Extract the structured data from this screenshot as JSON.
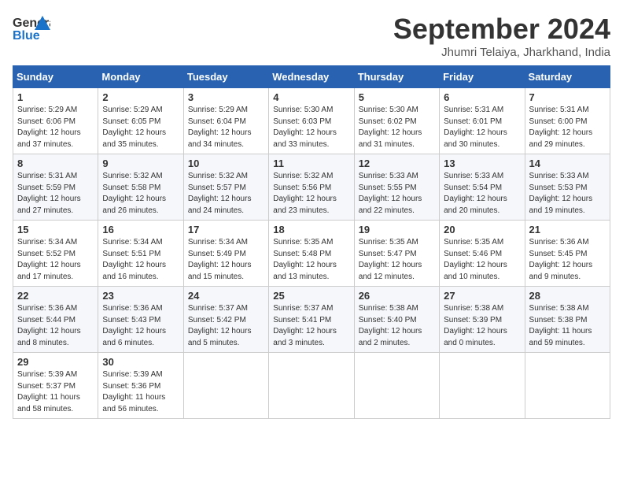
{
  "header": {
    "logo_line1": "General",
    "logo_line2": "Blue",
    "month_title": "September 2024",
    "location": "Jhumri Telaiya, Jharkhand, India"
  },
  "days_of_week": [
    "Sunday",
    "Monday",
    "Tuesday",
    "Wednesday",
    "Thursday",
    "Friday",
    "Saturday"
  ],
  "weeks": [
    [
      {
        "day": "1",
        "lines": [
          "Sunrise: 5:29 AM",
          "Sunset: 6:06 PM",
          "Daylight: 12 hours",
          "and 37 minutes."
        ]
      },
      {
        "day": "2",
        "lines": [
          "Sunrise: 5:29 AM",
          "Sunset: 6:05 PM",
          "Daylight: 12 hours",
          "and 35 minutes."
        ]
      },
      {
        "day": "3",
        "lines": [
          "Sunrise: 5:29 AM",
          "Sunset: 6:04 PM",
          "Daylight: 12 hours",
          "and 34 minutes."
        ]
      },
      {
        "day": "4",
        "lines": [
          "Sunrise: 5:30 AM",
          "Sunset: 6:03 PM",
          "Daylight: 12 hours",
          "and 33 minutes."
        ]
      },
      {
        "day": "5",
        "lines": [
          "Sunrise: 5:30 AM",
          "Sunset: 6:02 PM",
          "Daylight: 12 hours",
          "and 31 minutes."
        ]
      },
      {
        "day": "6",
        "lines": [
          "Sunrise: 5:31 AM",
          "Sunset: 6:01 PM",
          "Daylight: 12 hours",
          "and 30 minutes."
        ]
      },
      {
        "day": "7",
        "lines": [
          "Sunrise: 5:31 AM",
          "Sunset: 6:00 PM",
          "Daylight: 12 hours",
          "and 29 minutes."
        ]
      }
    ],
    [
      {
        "day": "8",
        "lines": [
          "Sunrise: 5:31 AM",
          "Sunset: 5:59 PM",
          "Daylight: 12 hours",
          "and 27 minutes."
        ]
      },
      {
        "day": "9",
        "lines": [
          "Sunrise: 5:32 AM",
          "Sunset: 5:58 PM",
          "Daylight: 12 hours",
          "and 26 minutes."
        ]
      },
      {
        "day": "10",
        "lines": [
          "Sunrise: 5:32 AM",
          "Sunset: 5:57 PM",
          "Daylight: 12 hours",
          "and 24 minutes."
        ]
      },
      {
        "day": "11",
        "lines": [
          "Sunrise: 5:32 AM",
          "Sunset: 5:56 PM",
          "Daylight: 12 hours",
          "and 23 minutes."
        ]
      },
      {
        "day": "12",
        "lines": [
          "Sunrise: 5:33 AM",
          "Sunset: 5:55 PM",
          "Daylight: 12 hours",
          "and 22 minutes."
        ]
      },
      {
        "day": "13",
        "lines": [
          "Sunrise: 5:33 AM",
          "Sunset: 5:54 PM",
          "Daylight: 12 hours",
          "and 20 minutes."
        ]
      },
      {
        "day": "14",
        "lines": [
          "Sunrise: 5:33 AM",
          "Sunset: 5:53 PM",
          "Daylight: 12 hours",
          "and 19 minutes."
        ]
      }
    ],
    [
      {
        "day": "15",
        "lines": [
          "Sunrise: 5:34 AM",
          "Sunset: 5:52 PM",
          "Daylight: 12 hours",
          "and 17 minutes."
        ]
      },
      {
        "day": "16",
        "lines": [
          "Sunrise: 5:34 AM",
          "Sunset: 5:51 PM",
          "Daylight: 12 hours",
          "and 16 minutes."
        ]
      },
      {
        "day": "17",
        "lines": [
          "Sunrise: 5:34 AM",
          "Sunset: 5:49 PM",
          "Daylight: 12 hours",
          "and 15 minutes."
        ]
      },
      {
        "day": "18",
        "lines": [
          "Sunrise: 5:35 AM",
          "Sunset: 5:48 PM",
          "Daylight: 12 hours",
          "and 13 minutes."
        ]
      },
      {
        "day": "19",
        "lines": [
          "Sunrise: 5:35 AM",
          "Sunset: 5:47 PM",
          "Daylight: 12 hours",
          "and 12 minutes."
        ]
      },
      {
        "day": "20",
        "lines": [
          "Sunrise: 5:35 AM",
          "Sunset: 5:46 PM",
          "Daylight: 12 hours",
          "and 10 minutes."
        ]
      },
      {
        "day": "21",
        "lines": [
          "Sunrise: 5:36 AM",
          "Sunset: 5:45 PM",
          "Daylight: 12 hours",
          "and 9 minutes."
        ]
      }
    ],
    [
      {
        "day": "22",
        "lines": [
          "Sunrise: 5:36 AM",
          "Sunset: 5:44 PM",
          "Daylight: 12 hours",
          "and 8 minutes."
        ]
      },
      {
        "day": "23",
        "lines": [
          "Sunrise: 5:36 AM",
          "Sunset: 5:43 PM",
          "Daylight: 12 hours",
          "and 6 minutes."
        ]
      },
      {
        "day": "24",
        "lines": [
          "Sunrise: 5:37 AM",
          "Sunset: 5:42 PM",
          "Daylight: 12 hours",
          "and 5 minutes."
        ]
      },
      {
        "day": "25",
        "lines": [
          "Sunrise: 5:37 AM",
          "Sunset: 5:41 PM",
          "Daylight: 12 hours",
          "and 3 minutes."
        ]
      },
      {
        "day": "26",
        "lines": [
          "Sunrise: 5:38 AM",
          "Sunset: 5:40 PM",
          "Daylight: 12 hours",
          "and 2 minutes."
        ]
      },
      {
        "day": "27",
        "lines": [
          "Sunrise: 5:38 AM",
          "Sunset: 5:39 PM",
          "Daylight: 12 hours",
          "and 0 minutes."
        ]
      },
      {
        "day": "28",
        "lines": [
          "Sunrise: 5:38 AM",
          "Sunset: 5:38 PM",
          "Daylight: 11 hours",
          "and 59 minutes."
        ]
      }
    ],
    [
      {
        "day": "29",
        "lines": [
          "Sunrise: 5:39 AM",
          "Sunset: 5:37 PM",
          "Daylight: 11 hours",
          "and 58 minutes."
        ]
      },
      {
        "day": "30",
        "lines": [
          "Sunrise: 5:39 AM",
          "Sunset: 5:36 PM",
          "Daylight: 11 hours",
          "and 56 minutes."
        ]
      },
      null,
      null,
      null,
      null,
      null
    ]
  ]
}
